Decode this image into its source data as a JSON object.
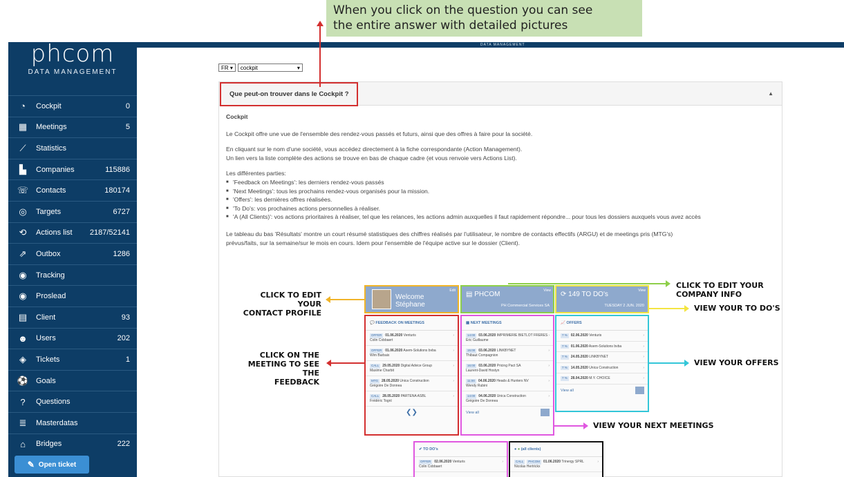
{
  "callout": {
    "text_line1": "When you click on the question you can see",
    "text_line2": "the entire answer with detailed pictures"
  },
  "topbar": {
    "brand": "DATA MANAGEMENT"
  },
  "logo": {
    "word": "phcom",
    "sub": "DATA MANAGEMENT"
  },
  "nav": [
    {
      "label": "Cockpit",
      "count": "0",
      "icon": "speedometer-icon"
    },
    {
      "label": "Meetings",
      "count": "5",
      "icon": "calendar-icon"
    },
    {
      "label": "Statistics",
      "count": "",
      "icon": "chart-line-icon"
    },
    {
      "label": "Companies",
      "count": "115886",
      "icon": "buildings-icon"
    },
    {
      "label": "Contacts",
      "count": "180174",
      "icon": "contact-chat-icon"
    },
    {
      "label": "Targets",
      "count": "6727",
      "icon": "target-icon"
    },
    {
      "label": "Actions list",
      "count": "2187/52141",
      "icon": "cycle-icon"
    },
    {
      "label": "Outbox",
      "count": "1286",
      "icon": "outbox-icon"
    },
    {
      "label": "Tracking",
      "count": "",
      "icon": "record-icon"
    },
    {
      "label": "Proslead",
      "count": "",
      "icon": "record-icon"
    },
    {
      "label": "Client",
      "count": "93",
      "icon": "id-card-icon"
    },
    {
      "label": "Users",
      "count": "202",
      "icon": "users-icon"
    },
    {
      "label": "Tickets",
      "count": "1",
      "icon": "ticket-icon"
    },
    {
      "label": "Goals",
      "count": "",
      "icon": "soccer-ball-icon"
    },
    {
      "label": "Questions",
      "count": "",
      "icon": "question-icon"
    },
    {
      "label": "Masterdatas",
      "count": "",
      "icon": "database-icon"
    },
    {
      "label": "Bridges",
      "count": "222",
      "icon": "bridge-icon"
    }
  ],
  "open_ticket": "Open ticket",
  "selects": {
    "lang": "FR",
    "page": "cockpit"
  },
  "question": "Que peut-on trouver dans le Cockpit ?",
  "answer": {
    "heading": "Cockpit",
    "p1": "Le Cockpit offre une vue de l'ensemble des rendez-vous passés et futurs, ainsi que des offres à faire pour la société.",
    "p2a": "En cliquant sur le nom d'une société, vous accédez directement à la fiche correspondante (Action Management).",
    "p2b": "Un lien vers la liste complète des actions se trouve en bas de chaque cadre (et vous renvoie vers Actions List).",
    "parts_intro": "Les différentes parties:",
    "parts": [
      "'Feedback on Meetings': les derniers rendez-vous passés",
      "'Next Meetings': tous les prochains rendez-vous organisés pour la mission.",
      "'Offers': les dernières offres réalisées.",
      "'To Do's: vos prochaines actions personnelles à réaliser.",
      "'A (All Clients)': vos actions prioritaires à réaliser, tel que les relances, les actions admin auxquelles il faut rapidement répondre... pour tous les dossiers auxquels vous avez accès"
    ],
    "p3a": "Le tableau du bas 'Résultats' montre un court résumé statistiques des chiffres réalisés par l'utilisateur, le nombre de contacts effectifs (ARGU) et de meetings pris (MTG's)",
    "p3b": "prévus/faits, sur la semaine/sur le mois en cours. Idem pour l'ensemble de l'équipe active sur le dossier (Client)."
  },
  "labels": {
    "edit_profile_1": "CLICK TO EDIT YOUR",
    "edit_profile_2": "CONTACT PROFILE",
    "edit_company_1": "CLICK TO EDIT YOUR",
    "edit_company_2": "COMPANY INFO",
    "todos": "VIEW YOUR TO DO'S",
    "meeting_1": "CLICK ON THE",
    "meeting_2": "MEETING TO SEE THE",
    "meeting_3": "FEEDBACK",
    "offers": "VIEW YOUR OFFERS",
    "next_meetings": "VIEW YOUR NEXT MEETINGS"
  },
  "cards": {
    "welcome": "Welcome",
    "welcome_name": "Stéphane",
    "edit": "Edit",
    "phcom": "PHCOM",
    "phcom_sub": "PH Commercial Services SA",
    "view": "View",
    "todos_title": "149 TO DO's",
    "todos_date": "TUESDAY 2 JUN. 2020",
    "feedback_title": "FEEDBACK ON MEETINGS",
    "feedback": [
      {
        "tag": "OFFER",
        "date": "01.06.2020",
        "co": "Venturis",
        "who": "Colin Cobbaert"
      },
      {
        "tag": "OFFER",
        "date": "01.06.2020",
        "co": "Asem-Solutions bvba",
        "who": "Wim Barbaix"
      },
      {
        "tag": "CALL",
        "date": "29.05.2020",
        "co": "Digital Advice Group",
        "who": "Maxime Charbit"
      },
      {
        "tag": "MTG",
        "date": "28.05.2020",
        "co": "Unica Construction",
        "who": "Grégoire De Donnea"
      },
      {
        "tag": "CALL",
        "date": "28.05.2020",
        "co": "PARTENA ASBL",
        "who": "Frédéric Tognl"
      }
    ],
    "next_title": "NEXT MEETINGS",
    "next": [
      {
        "tag": "14:00",
        "date": "03.06.2020",
        "co": "IMPRIMERIE BIETLOT FRERES",
        "who": "Eric Guillaume"
      },
      {
        "tag": "15:00",
        "date": "03.06.2020",
        "co": "LINKBYNET",
        "who": "Thibaut Compagnion"
      },
      {
        "tag": "16:00",
        "date": "03.06.2020",
        "co": "Pricing Pact SA",
        "who": "Laurent-David Hostyn"
      },
      {
        "tag": "11:00",
        "date": "04.06.2020",
        "co": "Heads & Hunters NV",
        "who": "Wendy Rubini"
      },
      {
        "tag": "14:00",
        "date": "04.06.2020",
        "co": "Unica Construction",
        "who": "Grégoire De Donnea"
      }
    ],
    "offers_title": "OFFERS",
    "offers": [
      {
        "tag": "7 %",
        "date": "02.06.2020",
        "co": "Venturis"
      },
      {
        "tag": "7 %",
        "date": "01.06.2020",
        "co": "Asem-Solutions bvba"
      },
      {
        "tag": "7 %",
        "date": "24.05.2020",
        "co": "LINKBYNET"
      },
      {
        "tag": "7 %",
        "date": "14.05.2020",
        "co": "Unica Construction"
      },
      {
        "tag": "7 %",
        "date": "28.04.2020",
        "co": "M.Y. CHOICE"
      }
    ],
    "view_all": "View all",
    "todo_box_title": "TO DO's",
    "todo_row": {
      "tag": "OFFER",
      "date": "02.06.2020",
      "co": "Venturis",
      "who": "Colin Cobbaert"
    },
    "all_title": "(all clients)",
    "all_row": {
      "tag": "CALL",
      "tag2": "PHCOM",
      "date": "01.06.2020",
      "co": "Trinergy SPRL",
      "who": "Nicolas Hertrickx"
    }
  },
  "colors": {
    "sidebar": "#0d3d66",
    "callout": "#c8e0b4",
    "red": "#d32f2f",
    "orange": "#f0b429",
    "green": "#8ecf4a",
    "yellow": "#f4e542",
    "cyan": "#33c6d8",
    "magenta": "#e057e0",
    "black": "#111111"
  }
}
